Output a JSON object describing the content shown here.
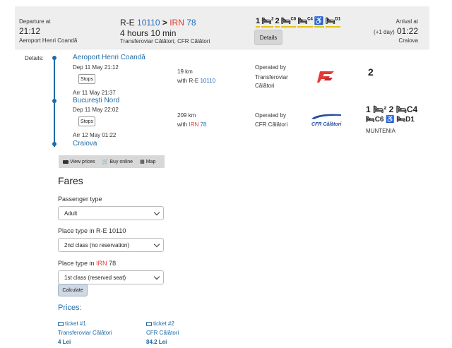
{
  "header": {
    "departure_label": "Departure at",
    "departure_time": "21:12",
    "departure_station": "Aeroport Henri Coandă",
    "train1_prefix": "R-E",
    "train1_number": "10110",
    "arrow": ">",
    "train2_prefix": "IRN",
    "train2_number": "78",
    "duration": "4 hours 10 min",
    "operators": "Transferoviar Călători, CFR Călători",
    "details_button": "Details",
    "arrival_label": "Arrival at",
    "arrival_day_offset": "(+1 day)",
    "arrival_time": "01:22",
    "arrival_station": "Craiova",
    "class_icons": [
      {
        "text": "1",
        "sup": ""
      },
      {
        "text": "🛏",
        "sup": "2"
      },
      {
        "text": "2",
        "sup": ""
      },
      {
        "text": "🛏",
        "sup": "C6"
      },
      {
        "text": "🛏",
        "sup": "C4"
      },
      {
        "text": "♿",
        "sup": ""
      },
      {
        "text": "🛏",
        "sup": "D1"
      }
    ]
  },
  "details": {
    "label": "Details:",
    "segment1": {
      "from_station": "Aeroport Henri Coandă",
      "dep": "Dep 11 May 21:12",
      "stops_button": "Stops",
      "arr": "Arr 11 May 21:37",
      "distance": "19 km",
      "with_prefix": "with R-E",
      "train_number": "10110",
      "operated_by_label": "Operated by",
      "operator": "Transferoviar Călători",
      "class_summary": "2"
    },
    "segment2": {
      "from_station": "București Nord",
      "dep": "Dep 11 May 22:02",
      "stops_button": "Stops",
      "arr": "Arr 12 May 01:22",
      "distance": "209 km",
      "with_prefix": "with",
      "train_category": "IRN",
      "train_number": "78",
      "operated_by_label": "Operated by",
      "operator": "CFR Călători",
      "logo_text": "CFR Călători",
      "class_row1": "1 🛏² 2 🛏C4",
      "class_row2": "🛏C6 ♿ 🛏D1",
      "train_name": "MUNTENIA"
    },
    "final_station": "Craiova",
    "toolbar": {
      "view_prices": "View prices",
      "buy_online": "Buy online",
      "map": "Map"
    }
  },
  "fares": {
    "title": "Fares",
    "passenger_type_label": "Passenger type",
    "passenger_type_value": "Adult",
    "place_type1_label_prefix": "Place type in R-E",
    "place_type1_label_number": "10110",
    "place_type1_value": "2nd class (no reservation)",
    "place_type2_label_prefix": "Place type in",
    "place_type2_label_category": "IRN",
    "place_type2_label_number": "78",
    "place_type2_value": "1st class (reserved seat)",
    "calculate_button": "Calculate"
  },
  "prices": {
    "title": "Prices:",
    "tickets": [
      {
        "label": "ticket #1",
        "operator": "Transferoviar Călători",
        "amount": "4 Lei"
      },
      {
        "label": "ticket #2",
        "operator": "CFR Călători",
        "amount": "84.2 Lei"
      }
    ]
  }
}
